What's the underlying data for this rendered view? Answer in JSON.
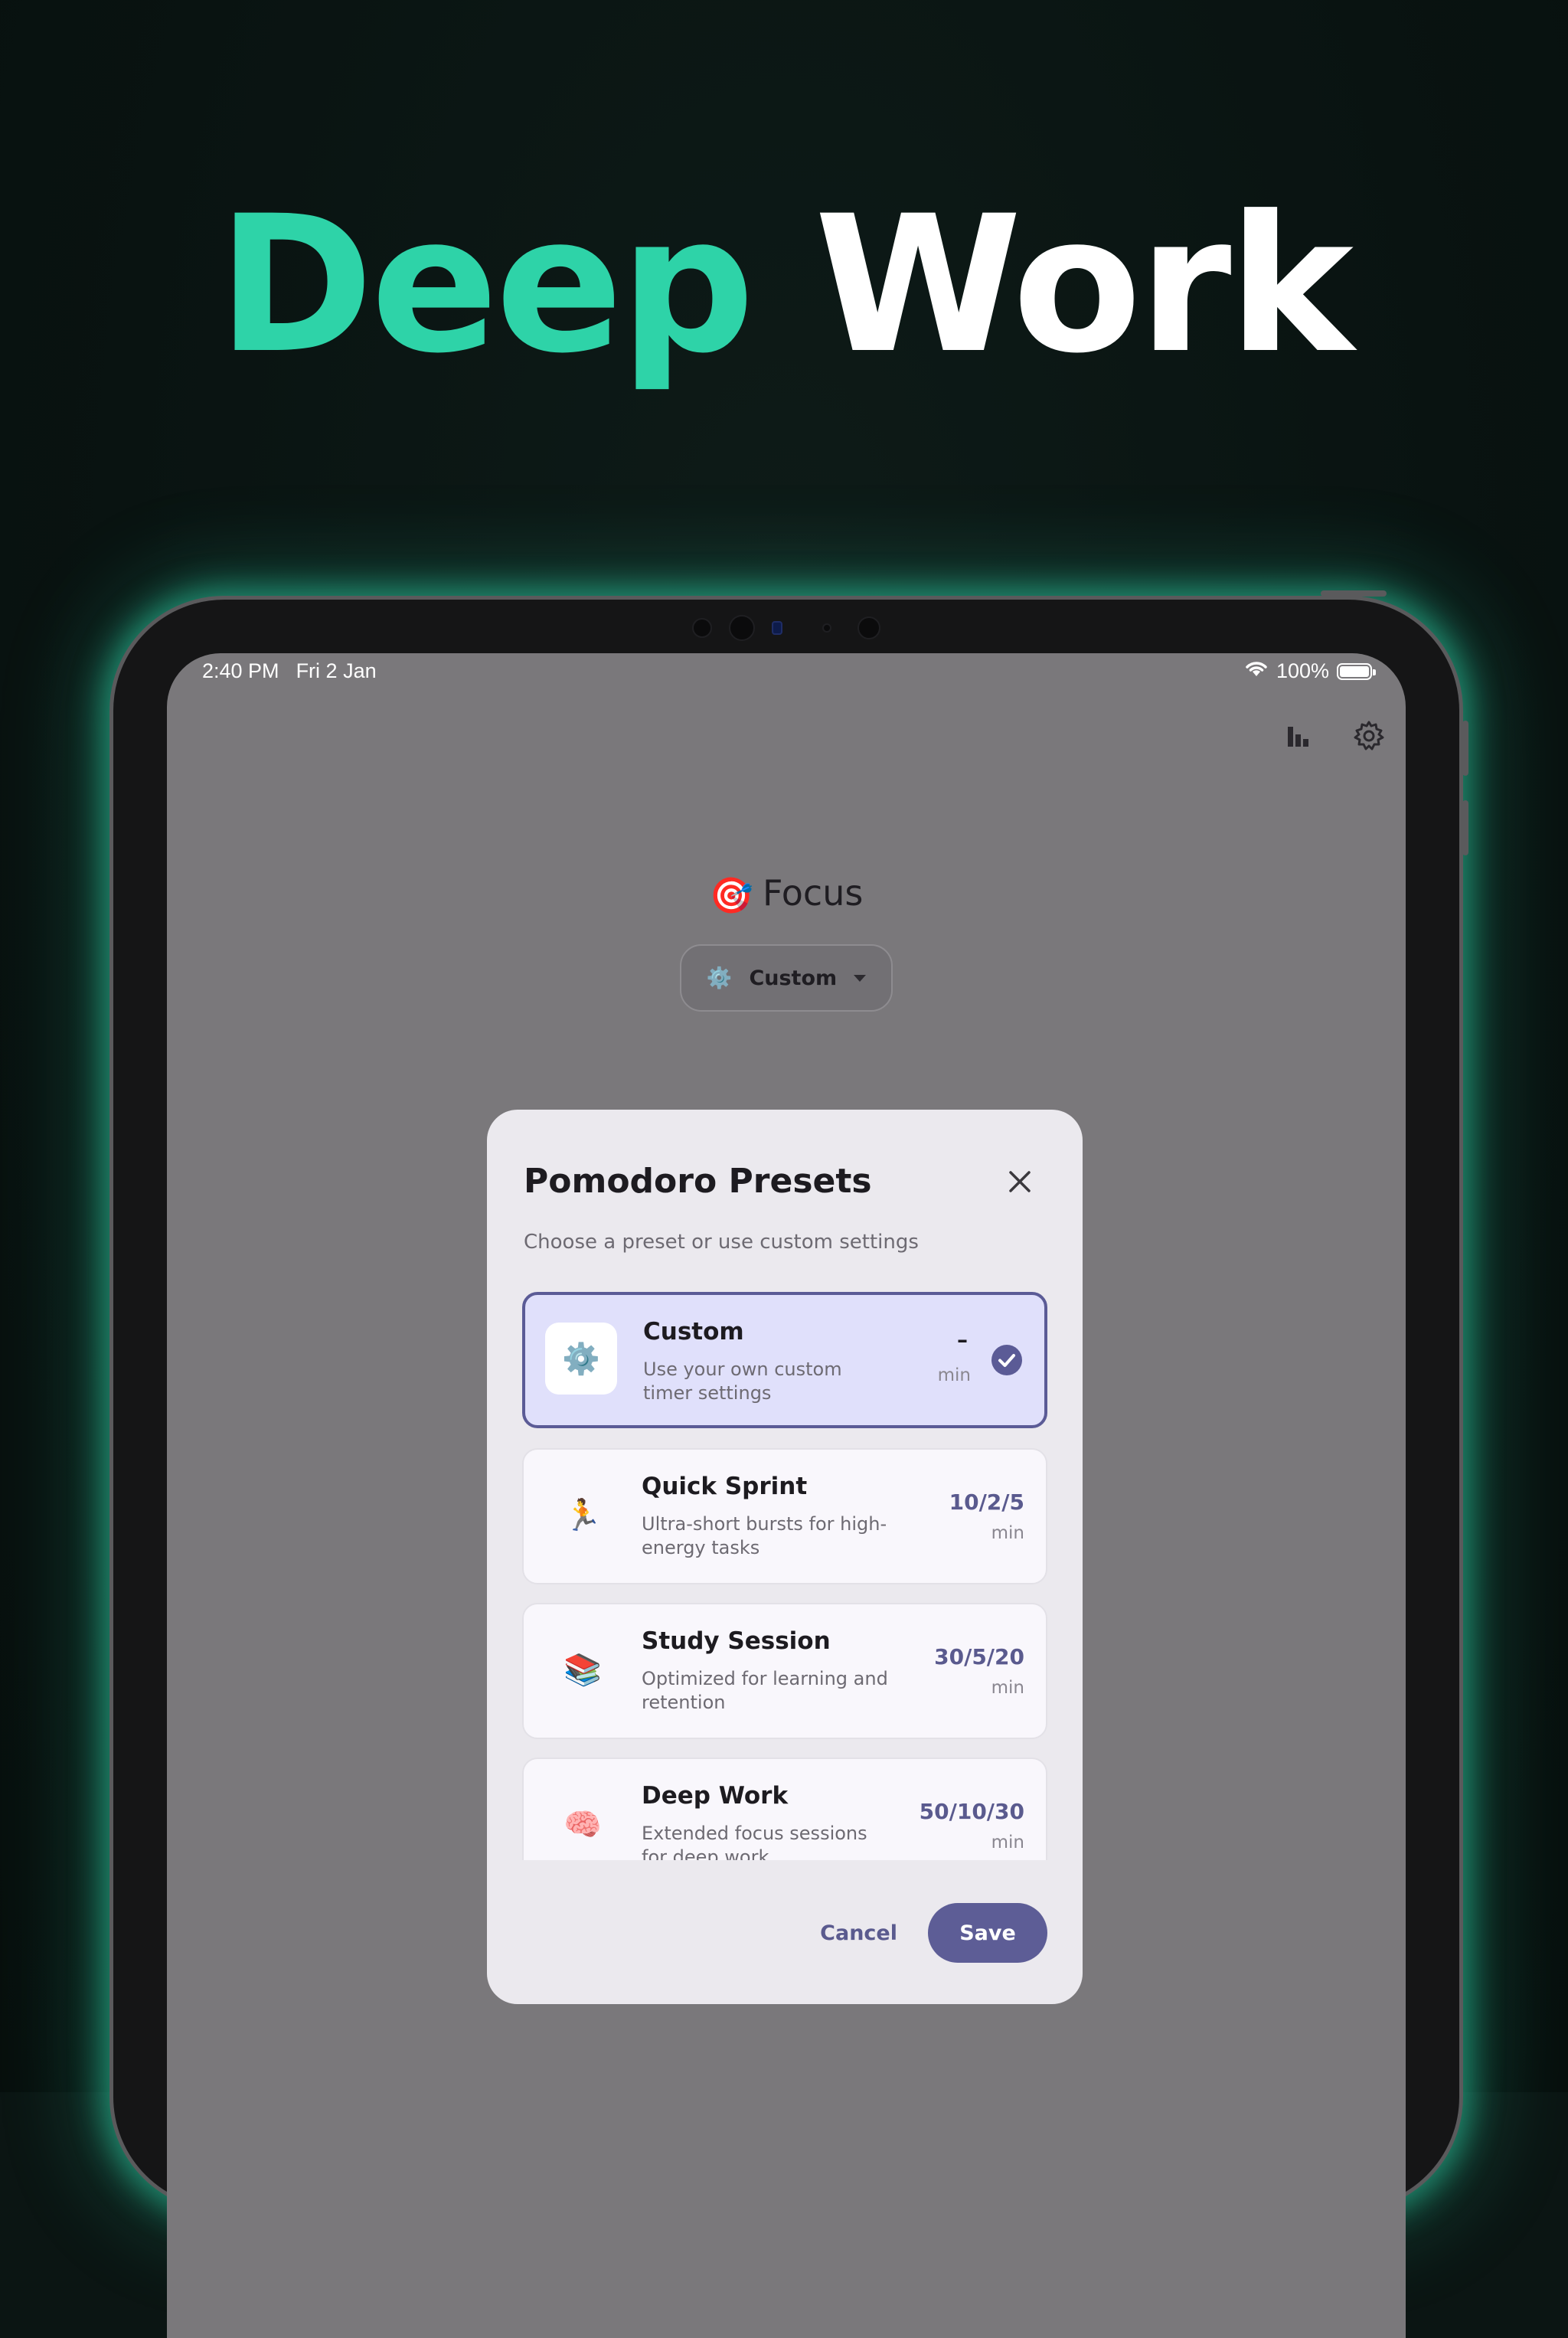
{
  "headline": {
    "accent_word": "Deep",
    "plain_word": "Work"
  },
  "status_bar": {
    "time": "2:40 PM",
    "date": "Fri 2 Jan",
    "battery": "100%",
    "battery_level_percent": 100
  },
  "toolbar": {
    "stats_icon": "bar-chart-icon",
    "settings_icon": "gear-icon"
  },
  "app": {
    "title": "Focus",
    "title_emoji": "🎯",
    "preset_selector": {
      "emoji": "⚙️",
      "label": "Custom"
    }
  },
  "modal": {
    "title": "Pomodoro Presets",
    "subtitle": "Choose a preset or use custom settings",
    "presets": [
      {
        "emoji": "⚙️",
        "name": "Custom",
        "description": "Use your own custom timer settings",
        "time": "–",
        "unit": "min",
        "selected": true
      },
      {
        "emoji": "🏃",
        "name": "Quick Sprint",
        "description": "Ultra-short bursts for high-energy tasks",
        "time": "10/2/5",
        "unit": "min",
        "selected": false
      },
      {
        "emoji": "📚",
        "name": "Study Session",
        "description": "Optimized for learning and retention",
        "time": "30/5/20",
        "unit": "min",
        "selected": false
      },
      {
        "emoji": "🧠",
        "name": "Deep Work",
        "description": "Extended focus sessions for deep work",
        "time": "50/10/30",
        "unit": "min",
        "selected": false
      }
    ],
    "cancel_label": "Cancel",
    "save_label": "Save"
  },
  "colors": {
    "accent": "#2ed3a8",
    "background": "#0b1513",
    "primary_button": "#5d5d96",
    "selected_card": "#e0e0fb"
  }
}
